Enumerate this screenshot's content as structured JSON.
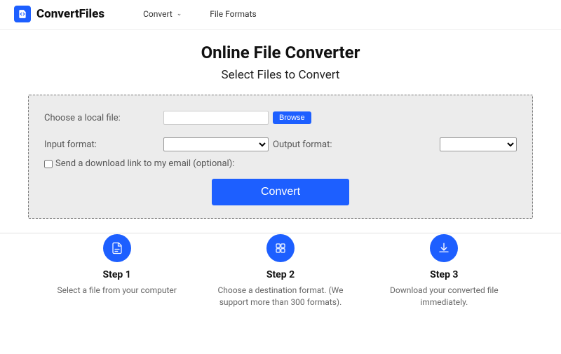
{
  "brand": "ConvertFiles",
  "nav": {
    "convert": "Convert",
    "formats": "File Formats"
  },
  "hero": {
    "title": "Online File Converter",
    "subtitle": "Select Files to Convert"
  },
  "form": {
    "choose_label": "Choose a local file:",
    "browse": "Browse",
    "input_format_label": "Input format:",
    "output_format_label": "Output format:",
    "email_checkbox_label": "Send a download link to my email (optional):",
    "convert_button": "Convert"
  },
  "steps": [
    {
      "title": "Step 1",
      "desc": "Select a file from your computer"
    },
    {
      "title": "Step 2",
      "desc": "Choose a destination format. (We support more than 300 formats)."
    },
    {
      "title": "Step 3",
      "desc": "Download your converted file immediately."
    }
  ]
}
